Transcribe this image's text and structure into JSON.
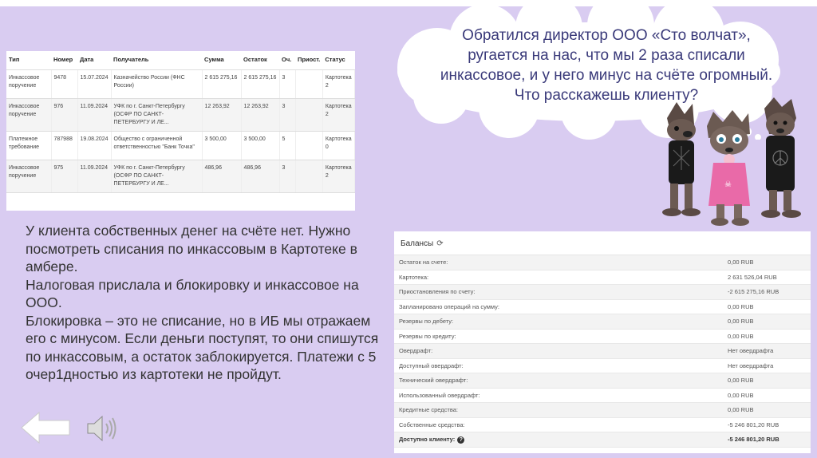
{
  "documents": {
    "headers": [
      "Тип",
      "Номер",
      "Дата",
      "Получатель",
      "Сумма",
      "Остаток",
      "Оч.",
      "Приост.",
      "Статус"
    ],
    "rows": [
      [
        "Инкассовое поручение",
        "9478",
        "15.07.2024",
        "Казначейство России (ФНС России)",
        "2 615 275,16",
        "2 615 275,16",
        "3",
        "",
        "Картотека 2"
      ],
      [
        "Инкассовое поручение",
        "976",
        "11.09.2024",
        "УФК по г. Санкт-Петербургу (ОСФР ПО САНКТ-ПЕТЕРБУРГУ И ЛЕ...",
        "12 263,92",
        "12 263,92",
        "3",
        "",
        "Картотека 2"
      ],
      [
        "Платежное требование",
        "787988",
        "19.08.2024",
        "Общество с ограниченной ответственностью \"Банк Точка\"",
        "3 500,00",
        "3 500,00",
        "5",
        "",
        "Картотека 0"
      ],
      [
        "Инкассовое поручение",
        "975",
        "11.09.2024",
        "УФК по г. Санкт-Петербургу (ОСФР ПО САНКТ-ПЕТЕРБУРГУ И ЛЕ...",
        "486,96",
        "486,96",
        "3",
        "",
        "Картотека 2"
      ]
    ]
  },
  "main_text": {
    "p1": "У клиента собственных денег на счёте нет. Нужно посмотреть списания по инкассовым в Картотеке в амбере.",
    "p2": "Налоговая прислала и блокировку и инкассовое на ООО.",
    "p3": "Блокировка – это не списание, но в ИБ мы отражаем его с минусом. Если деньги поступят, то они спишутся по инкассовым, а остаток заблокируется. Платежи с 5 очер1дностью из картотеки не пройдут."
  },
  "cloud": {
    "text": "Обратился директор ООО «Сто волчат», ругается на нас, что мы 2 раза списали инкассовое, и у него минус на счёте огромный. Что расскажешь клиенту?"
  },
  "balances": {
    "title": "Балансы",
    "rows": [
      {
        "label": "Остаток на счете:",
        "value": "0,00 RUB"
      },
      {
        "label": "Картотека:",
        "value": "2 631 526,04 RUB"
      },
      {
        "label": "Приостановления по счету:",
        "value": "-2 615 275,16 RUB"
      },
      {
        "label": "Запланировано операций на сумму:",
        "value": "0,00 RUB"
      },
      {
        "label": "Резервы по дебету:",
        "value": "0,00 RUB"
      },
      {
        "label": "Резервы по кредиту:",
        "value": "0,00 RUB"
      },
      {
        "label": "Овердрафт:",
        "value": "Нет овердрафта"
      },
      {
        "label": "Доступный овердрафт:",
        "value": "Нет овердрафта"
      },
      {
        "label": "Технический овердрафт:",
        "value": "0,00 RUB"
      },
      {
        "label": "Использованный овердрафт:",
        "value": "0,00 RUB"
      },
      {
        "label": "Кредитные средства:",
        "value": "0,00 RUB"
      },
      {
        "label": "Собственные средства:",
        "value": "-5 246 801,20 RUB"
      }
    ],
    "total": {
      "label": "Доступно клиенту:",
      "value": "-5 246 801,20 RUB",
      "help": "?"
    }
  },
  "colors": {
    "background": "#d9ccf1",
    "cloud_text": "#3a3a7a"
  }
}
